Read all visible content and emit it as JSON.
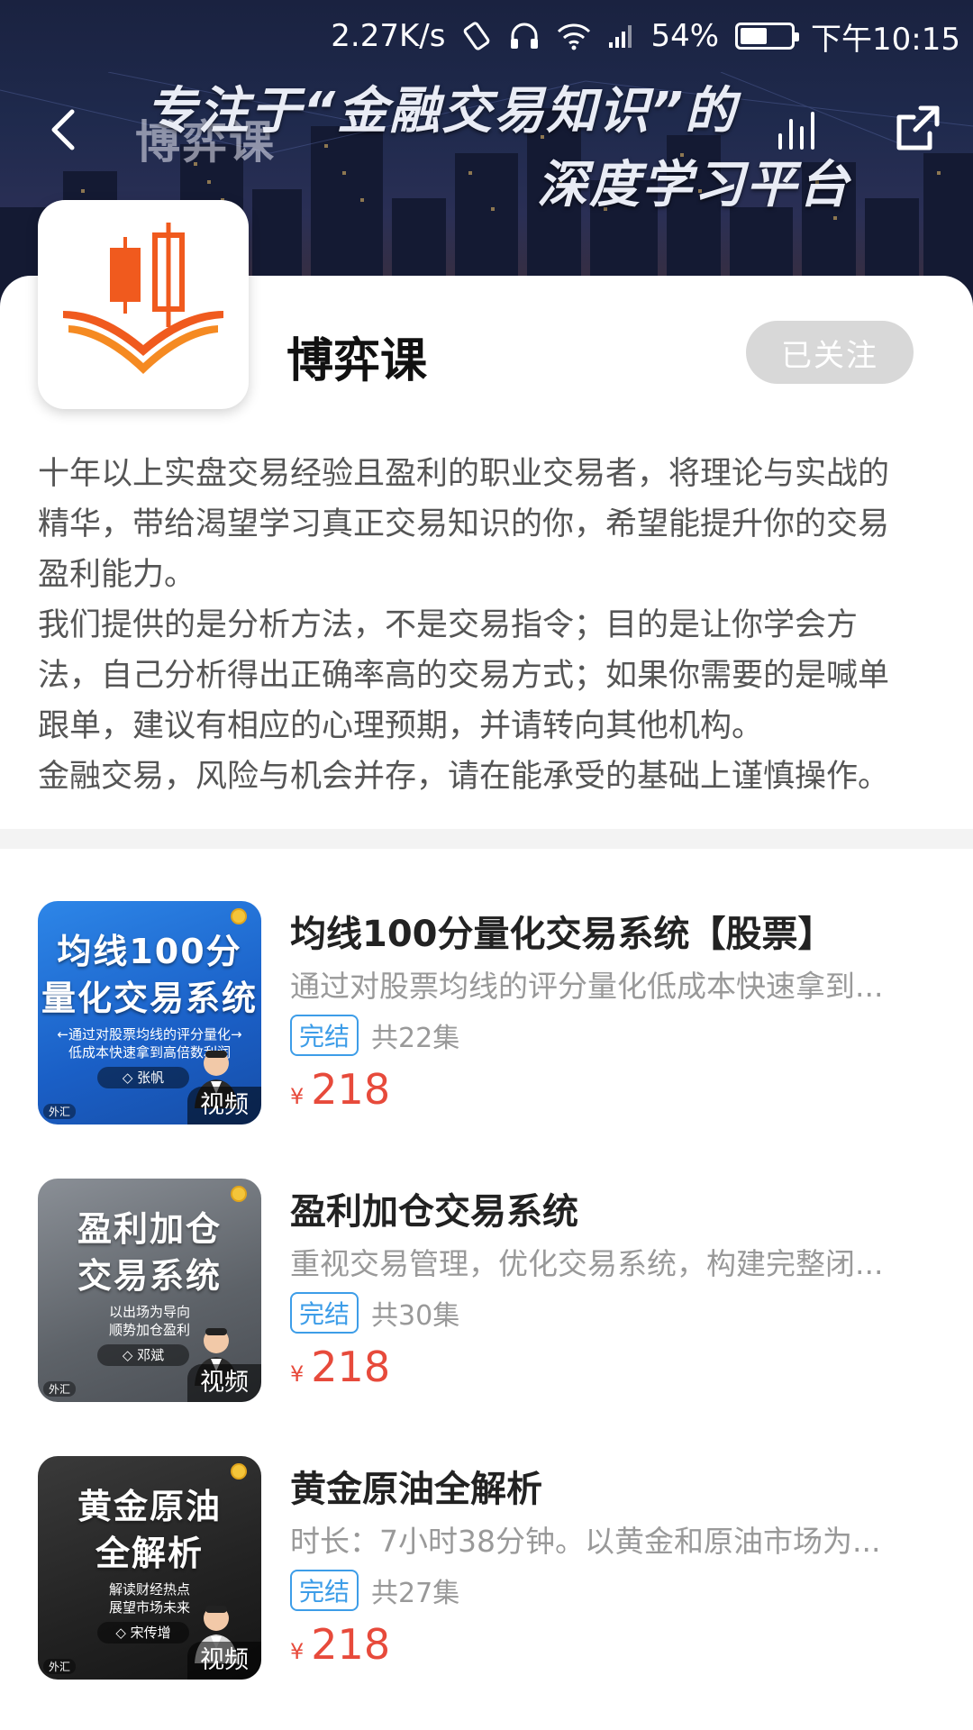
{
  "status_bar": {
    "speed": "2.27K/s",
    "battery": "54%",
    "battery_level": 0.54,
    "time": "下午10:15"
  },
  "banner": {
    "slogan_line1": "专注于“金融交易知识”的",
    "slogan_line2": "深度学习平台",
    "brand": "博弈课"
  },
  "channel": {
    "name": "博弈课",
    "follow_label": "已关注",
    "description": [
      "十年以上实盘交易经验且盈利的职业交易者，将理论与实战的",
      "精华，带给渴望学习真正交易知识的你，希望能提升你的交易",
      "盈利能力。",
      "我们提供的是分析方法，不是交易指令；目的是让你学会方",
      "法，自己分析得出正确率高的交易方式；如果你需要的是喊单",
      "跟单，建议有相应的心理预期，并请转向其他机构。",
      "金融交易，风险与机会并存，请在能承受的基础上谨慎操作。"
    ]
  },
  "courses": [
    {
      "title": "均线100分量化交易系统【股票】",
      "description": "通过对股票均线的评分量化低成本快速拿到...",
      "status": "完结",
      "episodes": "共22集",
      "currency": "¥",
      "price": "218",
      "media_tag": "视频",
      "thumb": {
        "title_line1": "均线100分",
        "title_line2": "量化交易系统",
        "sub_line1": "←通过对股票均线的评分量化→",
        "sub_line2": "低成本快速拿到高倍数利润",
        "teacher": "◇ 张帆",
        "market": "外汇"
      }
    },
    {
      "title": "盈利加仓交易系统",
      "description": "重视交易管理，优化交易系统，构建完整闭...",
      "status": "完结",
      "episodes": "共30集",
      "currency": "¥",
      "price": "218",
      "media_tag": "视频",
      "thumb": {
        "title_line1": "盈利加仓",
        "title_line2": "交易系统",
        "sub_line1": "以出场为导向",
        "sub_line2": "顺势加仓盈利",
        "teacher": "◇ 邓斌",
        "market": "外汇"
      }
    },
    {
      "title": "黄金原油全解析",
      "description": "时长：7小时38分钟。以黄金和原油市场为...",
      "status": "完结",
      "episodes": "共27集",
      "currency": "¥",
      "price": "218",
      "media_tag": "视频",
      "thumb": {
        "title_line1": "黄金原油",
        "title_line2": "全解析",
        "sub_line1": "解读财经热点",
        "sub_line2": "展望市场未来",
        "teacher": "◇ 宋传增",
        "market": "外汇"
      }
    }
  ],
  "colors": {
    "accent_price": "#e74a3b",
    "status_blue": "#3d9de8",
    "logo_orange": "#f05a1e"
  }
}
